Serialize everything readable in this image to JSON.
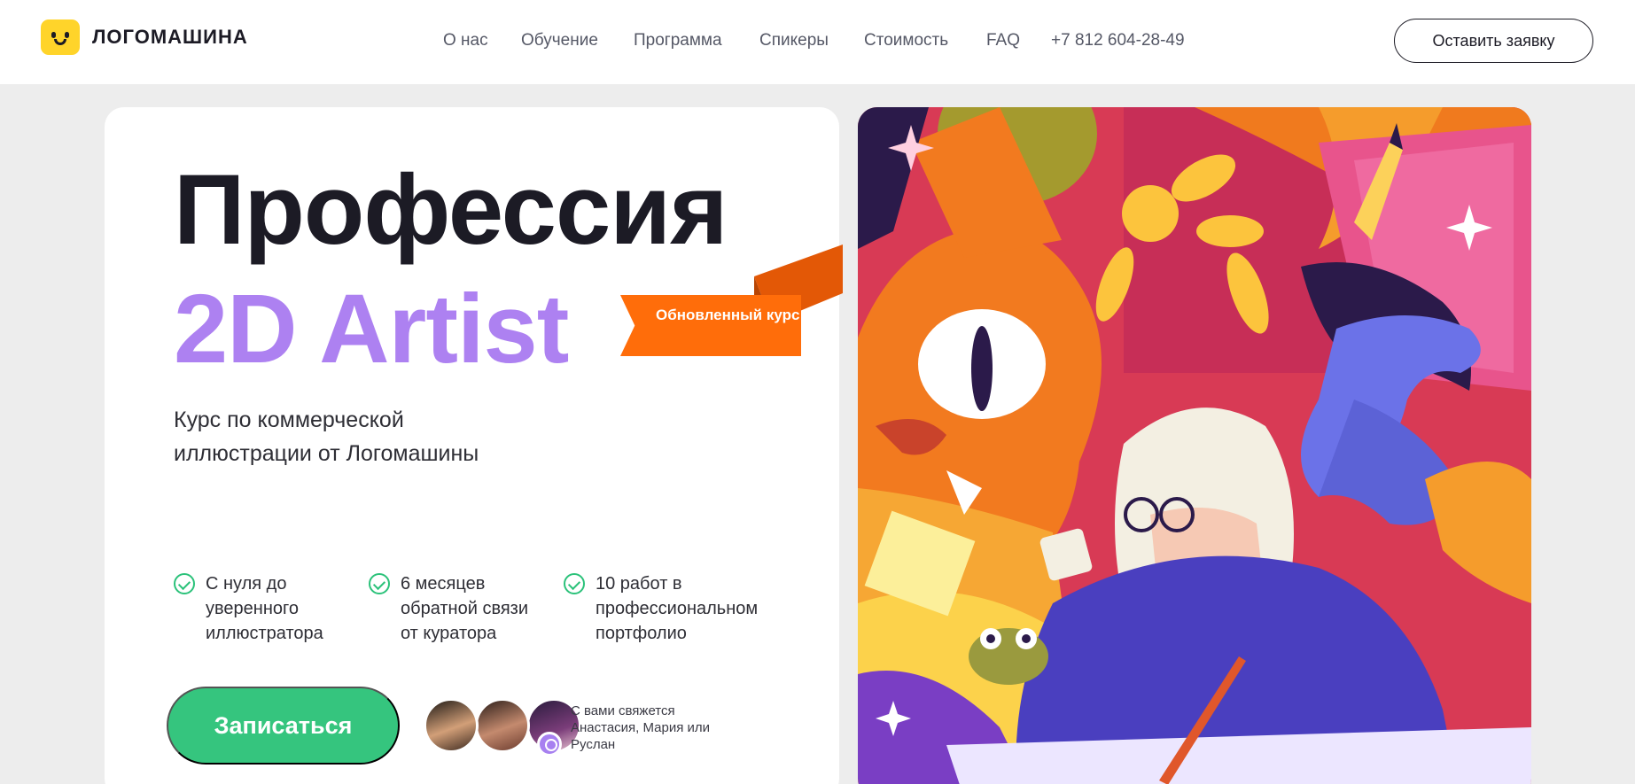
{
  "header": {
    "logo_text": "ЛОГОМАШИНА",
    "nav": [
      {
        "label": "О нас"
      },
      {
        "label": "Обучение"
      },
      {
        "label": "Программа"
      },
      {
        "label": "Спикеры"
      },
      {
        "label": "Стоимость"
      },
      {
        "label": "FAQ"
      },
      {
        "label": "+7 812 604-28-49"
      }
    ],
    "cta_label": "Оставить заявку"
  },
  "hero": {
    "title_line1": "Профессия",
    "title_line2": "2D Artist",
    "badge_label": "Обновленный курс",
    "subtitle": "Курс по коммерческой иллюстрации от Логомашины",
    "features": [
      {
        "text": "С нуля до уверенного иллюстратора"
      },
      {
        "text": "6 месяцев обратной связи от куратора"
      },
      {
        "text": "10 работ в профессиональном портфолио"
      }
    ],
    "enroll_label": "Записаться",
    "contact_note": "С вами свяжется Анастасия, Мария или Руслан"
  },
  "colors": {
    "accent_purple": "#ad81f1",
    "badge_orange": "#ff6d0a",
    "button_green": "#35c57e",
    "logo_yellow": "#ffd42a"
  }
}
